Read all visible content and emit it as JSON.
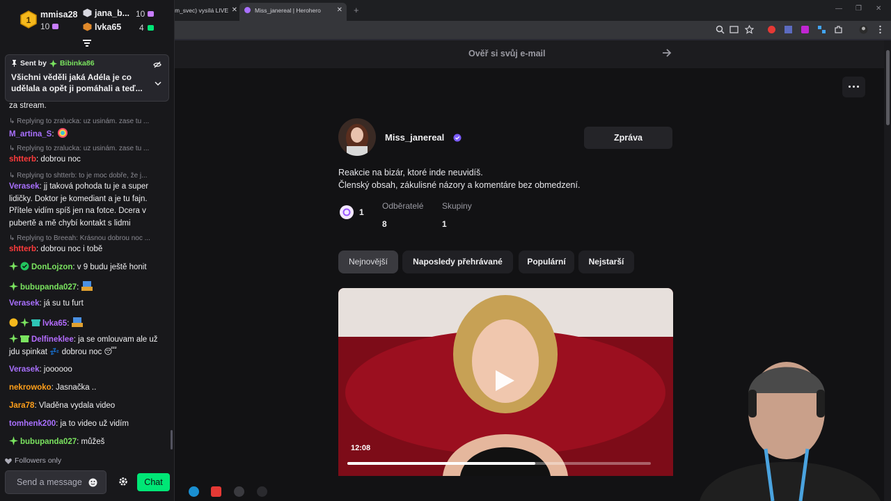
{
  "chat": {
    "leaderboard": [
      {
        "name": "mmisa28",
        "count": "10",
        "rank": "1"
      },
      {
        "name": "jana_b...",
        "count": "10"
      },
      {
        "name": "lvka65",
        "count": "4"
      }
    ],
    "pinned": {
      "sent_by_label": "Sent by",
      "sender": "Bibinka86",
      "message": "Všichni věděli jaká Adéla je co udělala a opět ji pomáhali a teď..."
    },
    "messages": [
      {
        "text": "za stream."
      },
      {
        "reply": "Replying to zralucka: uz usinám. zase tu ..."
      },
      {
        "user": "M_artina_S",
        "text": ""
      },
      {
        "reply": "Replying to zralucka: uz usinám. zase tu ..."
      },
      {
        "user": "shtterb",
        "text": ": dobrou noc"
      },
      {
        "reply": "Replying to shtterb: to je moc dobře, že j..."
      },
      {
        "user": "Verasek",
        "text": ": jj taková pohoda tu je a super lidičky. Doktor je komediant a je tu fajn. Přítele vidím spíš jen na fotce. Dcera v pubertě a mě chybí kontakt s lidmi"
      },
      {
        "reply": "Replying to Breeah: Krásnou dobrou noc ..."
      },
      {
        "user": "shtterb",
        "text": ": dobrou noc i tobě"
      },
      {
        "user": "DonLojzon",
        "text": ": v 9 budu ještě honit"
      },
      {
        "user": "bubupanda027",
        "text": ":"
      },
      {
        "user": "Verasek",
        "text": ": já su tu furt"
      },
      {
        "user": "lvka65",
        "text": ":"
      },
      {
        "user": "Delfineklee",
        "text": ": ja se omlouvam ale už jdu spinkat 💤 dobrou noc 😴"
      },
      {
        "user": "Verasek",
        "text": ": joooooo"
      },
      {
        "user": "nekrowoko",
        "text": ": Jasnačka .."
      },
      {
        "user": "Jara78",
        "text": ": Vladěna vydala video"
      },
      {
        "user": "tomhenk200",
        "text": ": ja to video už vidím"
      },
      {
        "user": "bubupanda027",
        "text": ": můžeš"
      }
    ],
    "followers_only": "Followers only",
    "send_placeholder": "Send a message",
    "chat_button": "Chat"
  },
  "browser": {
    "tabs": [
      {
        "title": "m_svec) vysílá LIVE"
      },
      {
        "title": "Miss_janereal | Herohero"
      }
    ],
    "new_tab": "+",
    "verify_banner": "Ověř si svůj e-mail",
    "profile": {
      "name": "Miss_janereal",
      "message_button": "Zpráva",
      "bio_line1": "Reakcie na bizár, ktoré inde neuvidíš.",
      "bio_line2": "Členský obsah, zákulisné názory a komentáre bez obmedzení.",
      "posts_count": "1",
      "subscribers_label": "Odběratelé",
      "subscribers_value": "8",
      "groups_label": "Skupiny",
      "groups_value": "1"
    },
    "filters": [
      "Nejnovější",
      "Naposledy přehrávané",
      "Populární",
      "Nejstarší"
    ],
    "video": {
      "duration": "12:08",
      "progress": 0.62
    }
  },
  "colors": {
    "chat_accent": "#00e676",
    "username_purple": "#a970ff",
    "username_red": "#ff3b3b",
    "username_green": "#7ae35f",
    "username_orange": "#ff9f1a"
  }
}
